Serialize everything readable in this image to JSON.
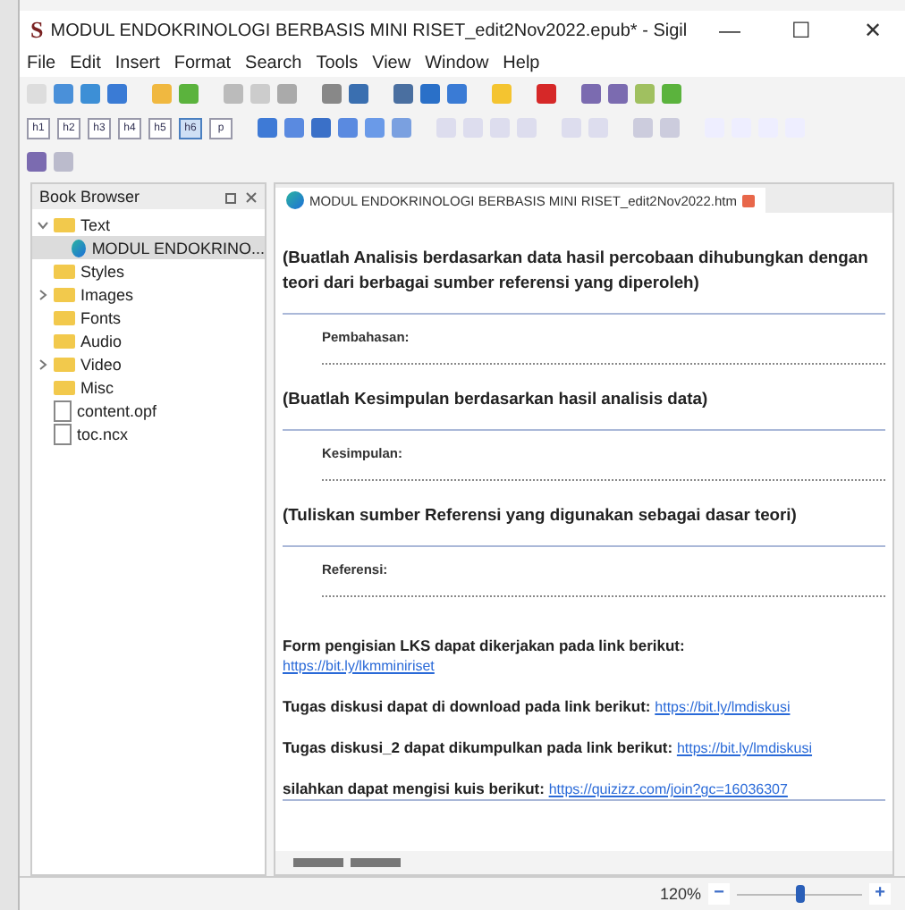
{
  "window": {
    "logo": "S",
    "title": "MODUL ENDOKRINOLOGI BERBASIS MINI RISET_edit2Nov2022.epub* - Sigil",
    "controls": [
      "—",
      "☐",
      "✕"
    ]
  },
  "menu": [
    "File",
    "Edit",
    "Insert",
    "Format",
    "Search",
    "Tools",
    "View",
    "Window",
    "Help"
  ],
  "heading_buttons": [
    {
      "label": "h1",
      "selected": false
    },
    {
      "label": "h2",
      "selected": false
    },
    {
      "label": "h3",
      "selected": false
    },
    {
      "label": "h4",
      "selected": false
    },
    {
      "label": "h5",
      "selected": false
    },
    {
      "label": "h6",
      "selected": true
    },
    {
      "label": "p",
      "selected": false
    }
  ],
  "book_browser": {
    "title": "Book Browser",
    "items": [
      {
        "label": "Text",
        "kind": "folder",
        "expanded": true,
        "children": [
          {
            "label": "MODUL ENDOKRINO...",
            "kind": "page",
            "selected": true
          }
        ]
      },
      {
        "label": "Styles",
        "kind": "folder"
      },
      {
        "label": "Images",
        "kind": "folder",
        "expanded": false
      },
      {
        "label": "Fonts",
        "kind": "folder"
      },
      {
        "label": "Audio",
        "kind": "folder"
      },
      {
        "label": "Video",
        "kind": "folder",
        "expanded": false
      },
      {
        "label": "Misc",
        "kind": "folder"
      },
      {
        "label": "content.opf",
        "kind": "file"
      },
      {
        "label": "toc.ncx",
        "kind": "file"
      }
    ]
  },
  "editor": {
    "tab": "MODUL ENDOKRINOLOGI BERBASIS MINI RISET_edit2Nov2022.htm",
    "blocks": [
      {
        "kind": "heading",
        "text": "(Buatlah Analisis berdasarkan data hasil percobaan dihubungkan dengan teori dari berbagai sumber referensi yang diperoleh)"
      },
      {
        "kind": "rule"
      },
      {
        "kind": "field",
        "text": "Pembahasan:"
      },
      {
        "kind": "heading",
        "text": "(Buatlah Kesimpulan berdasarkan hasil analisis data)"
      },
      {
        "kind": "rule"
      },
      {
        "kind": "field",
        "text": "Kesimpulan:"
      },
      {
        "kind": "heading",
        "text": "(Tuliskan sumber Referensi yang digunakan sebagai dasar teori)"
      },
      {
        "kind": "rule"
      },
      {
        "kind": "field",
        "text": "Referensi:"
      },
      {
        "kind": "stacked",
        "text": "Form pengisian LKS dapat dikerjakan pada link berikut:",
        "link": "https://bit.ly/lkmminiriset"
      },
      {
        "kind": "inline",
        "text": "Tugas diskusi dapat di download pada link berikut:",
        "link": "https://bit.ly/lmdiskusi"
      },
      {
        "kind": "inline",
        "text": "Tugas diskusi_2 dapat dikumpulkan pada link berikut:",
        "link": "https://bit.ly/lmdiskusi"
      },
      {
        "kind": "inline",
        "text": "silahkan dapat mengisi kuis berikut:",
        "link": "https://quizizz.com/join?gc=16036307"
      },
      {
        "kind": "rule"
      }
    ]
  },
  "status_bar": {
    "zoom": "120%",
    "level": 0.5,
    "minus": "−",
    "plus": "+"
  }
}
